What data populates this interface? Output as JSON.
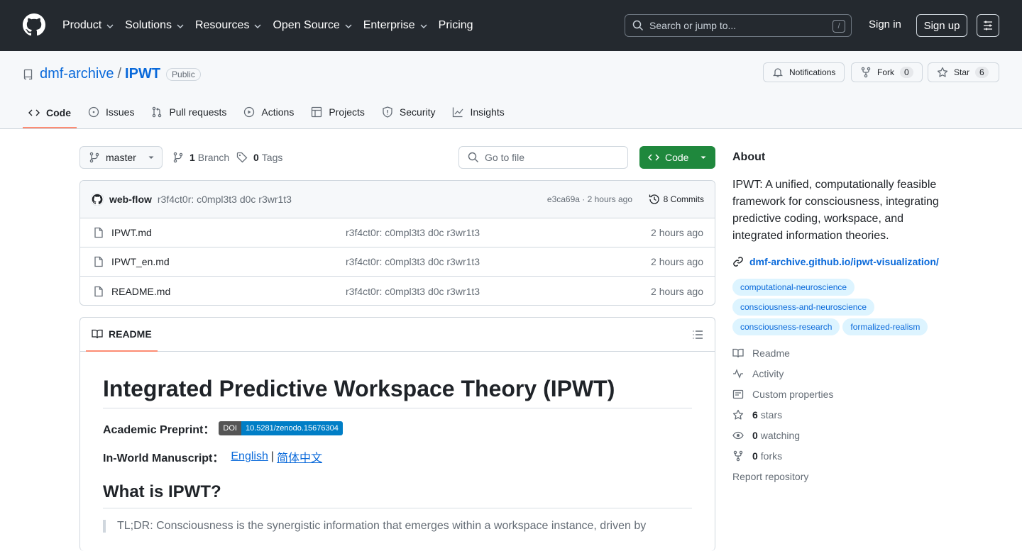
{
  "nav": {
    "items": [
      "Product",
      "Solutions",
      "Resources",
      "Open Source",
      "Enterprise",
      "Pricing"
    ],
    "search_placeholder": "Search or jump to...",
    "search_key": "/",
    "sign_in": "Sign in",
    "sign_up": "Sign up"
  },
  "repo": {
    "owner": "dmf-archive",
    "separator": "/",
    "name": "IPWT",
    "visibility": "Public",
    "notifications_label": "Notifications",
    "fork_label": "Fork",
    "fork_count": "0",
    "star_label": "Star",
    "star_count": "6"
  },
  "tabs": [
    "Code",
    "Issues",
    "Pull requests",
    "Actions",
    "Projects",
    "Security",
    "Insights"
  ],
  "toolbar": {
    "branch": "master",
    "branches_count": "1",
    "branches_label": "Branch",
    "tags_count": "0",
    "tags_label": "Tags",
    "go_to_file": "Go to file",
    "code_button": "Code"
  },
  "commit": {
    "author": "web-flow",
    "message": "r3f4ct0r: c0mpl3t3 d0c r3wr1t3",
    "sha_time": "e3ca69a · 2 hours ago",
    "commits": "8 Commits"
  },
  "files": [
    {
      "name": "IPWT.md",
      "message": "r3f4ct0r: c0mpl3t3 d0c r3wr1t3",
      "time": "2 hours ago"
    },
    {
      "name": "IPWT_en.md",
      "message": "r3f4ct0r: c0mpl3t3 d0c r3wr1t3",
      "time": "2 hours ago"
    },
    {
      "name": "README.md",
      "message": "r3f4ct0r: c0mpl3t3 d0c r3wr1t3",
      "time": "2 hours ago"
    }
  ],
  "readme": {
    "tab": "README",
    "title": "Integrated Predictive Workspace Theory (IPWT)",
    "preprint_label": "Academic Preprint：",
    "doi_left": "DOI",
    "doi_right": "10.5281/zenodo.15676304",
    "manuscript_label": "In-World Manuscript：",
    "link_english": "English",
    "link_sep": "|",
    "link_chinese": "简体中文",
    "h2": "What is IPWT?",
    "quote": "TL;DR: Consciousness is the synergistic information that emerges within a workspace instance, driven by"
  },
  "about": {
    "heading": "About",
    "description": "IPWT: A unified, computationally feasible framework for consciousness, integrating predictive coding, workspace, and integrated information theories.",
    "url": "dmf-archive.github.io/ipwt-visualization/",
    "topics": [
      "computational-neuroscience",
      "consciousness-and-neuroscience",
      "consciousness-research",
      "formalized-realism"
    ],
    "readme": "Readme",
    "activity": "Activity",
    "custom_properties": "Custom properties",
    "stars_count": "6",
    "stars_label": "stars",
    "watching_count": "0",
    "watching_label": "watching",
    "forks_count": "0",
    "forks_label": "forks",
    "report": "Report repository"
  }
}
